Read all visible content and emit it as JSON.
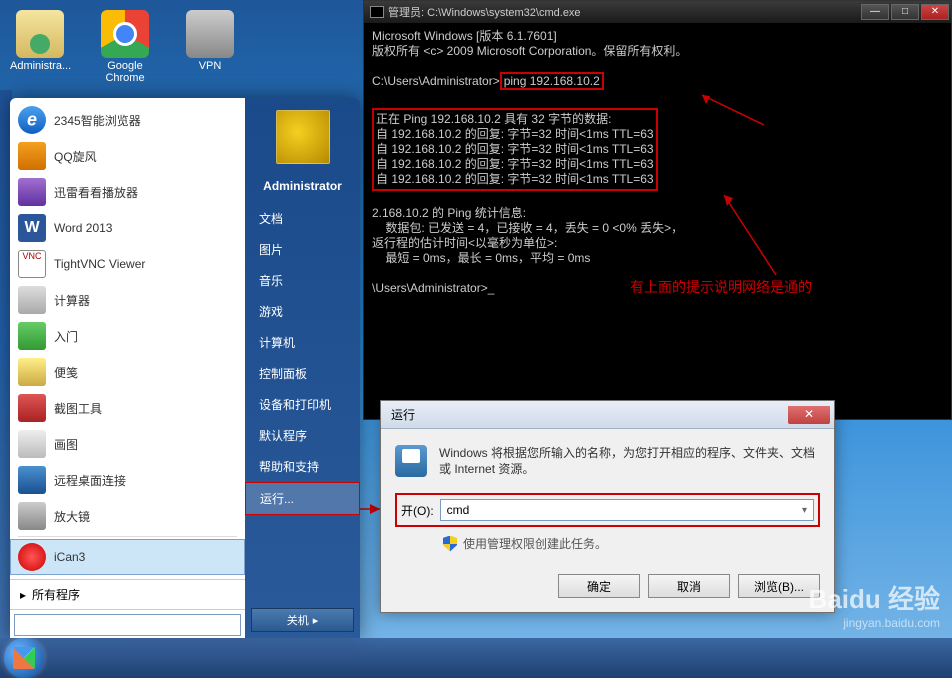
{
  "desktop": {
    "icons": [
      {
        "label": "Administra...",
        "name": "administrator-icon"
      },
      {
        "label": "Google Chrome",
        "name": "chrome-icon"
      },
      {
        "label": "VPN",
        "name": "vpn-icon"
      }
    ]
  },
  "cmd": {
    "title": "管理员: C:\\Windows\\system32\\cmd.exe",
    "line_version": "Microsoft Windows [版本 6.1.7601]",
    "line_copyright": "版权所有 <c> 2009 Microsoft Corporation。保留所有权利。",
    "prompt1_pre": "C:\\Users\\Administrator>",
    "prompt1_cmd": "ping 192.168.10.2",
    "ping_header": "正在 Ping 192.168.10.2 具有 32 字节的数据:",
    "ping_replies": [
      "自 192.168.10.2 的回复: 字节=32 时间<1ms TTL=63",
      "自 192.168.10.2 的回复: 字节=32 时间<1ms TTL=63",
      "自 192.168.10.2 的回复: 字节=32 时间<1ms TTL=63",
      "自 192.168.10.2 的回复: 字节=32 时间<1ms TTL=63"
    ],
    "stats_header": "2.168.10.2 的 Ping 统计信息:",
    "stats_packets": "    数据包: 已发送 = 4，已接收 = 4，丢失 = 0 <0% 丢失>，",
    "stats_rtt_header": "返行程的估计时间<以毫秒为单位>:",
    "stats_rtt": "    最短 = 0ms，最长 = 0ms，平均 = 0ms",
    "prompt2": "\\Users\\Administrator>_"
  },
  "annotation": {
    "text": "有上面的提示说明网络是通的"
  },
  "start_menu": {
    "pinned": [
      {
        "label": "2345智能浏览器",
        "cls": "c-2345"
      },
      {
        "label": "QQ旋风",
        "cls": "c-orange"
      },
      {
        "label": "迅雷看看播放器",
        "cls": "c-purple"
      },
      {
        "label": "Word 2013",
        "cls": "c-word"
      },
      {
        "label": "TightVNC Viewer",
        "cls": "c-vnc"
      },
      {
        "label": "计算器",
        "cls": "c-calc"
      },
      {
        "label": "入门",
        "cls": "c-green"
      },
      {
        "label": "便笺",
        "cls": "c-yellow"
      },
      {
        "label": "截图工具",
        "cls": "c-scissors"
      },
      {
        "label": "画图",
        "cls": "c-paint"
      },
      {
        "label": "远程桌面连接",
        "cls": "c-rdp"
      },
      {
        "label": "放大镜",
        "cls": "c-mag"
      },
      {
        "label": "iCan3",
        "cls": "c-red",
        "highlighted": true
      }
    ],
    "all_programs": "所有程序",
    "user": "Administrator",
    "right_links": [
      "文档",
      "图片",
      "音乐",
      "游戏",
      "计算机",
      "控制面板",
      "设备和打印机",
      "默认程序",
      "帮助和支持",
      "运行..."
    ],
    "run_highlighted_index": 9,
    "shutdown": "关机"
  },
  "run_dialog": {
    "title": "运行",
    "description": "Windows 将根据您所输入的名称，为您打开相应的程序、文件夹、文档或 Internet 资源。",
    "open_label": "开(O):",
    "open_value": "cmd",
    "admin_note": "使用管理权限创建此任务。",
    "buttons": {
      "ok": "确定",
      "cancel": "取消",
      "browse": "浏览(B)..."
    }
  },
  "watermark": {
    "brand": "Baidu 经验",
    "url": "jingyan.baidu.com"
  }
}
